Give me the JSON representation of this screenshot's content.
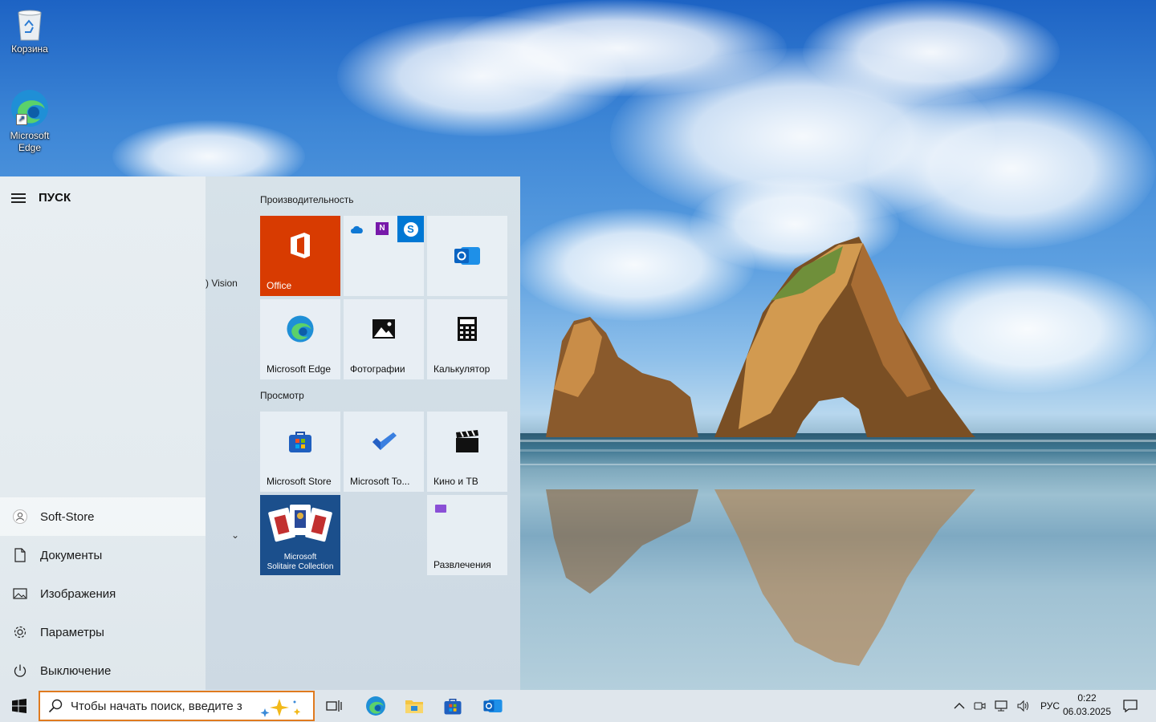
{
  "desktop": {
    "icons": [
      {
        "label": "Корзина"
      },
      {
        "label": "Microsoft Edge"
      }
    ]
  },
  "start_menu": {
    "title": "ПУСК",
    "partial_app_text": ") Vision",
    "nav": {
      "user": "Soft-Store",
      "documents": "Документы",
      "pictures": "Изображения",
      "settings": "Параметры",
      "power": "Выключение"
    },
    "groups": {
      "productivity": "Производительность",
      "explore": "Просмотр"
    },
    "tiles": {
      "office": "Office",
      "edge": "Microsoft Edge",
      "photos": "Фотографии",
      "calculator": "Калькулятор",
      "store": "Microsoft Store",
      "todo": "Microsoft To...",
      "movies": "Кино и ТВ",
      "solitaire_line1": "Microsoft",
      "solitaire_line2": "Solitaire Collection",
      "entertainment": "Развлечения"
    }
  },
  "taskbar": {
    "search_placeholder": "Чтобы начать поиск, введите з",
    "language": "РУС",
    "time": "0:22",
    "date": "06.03.2025"
  },
  "colors": {
    "office_tile": "#d83b01",
    "solitaire_tile": "#1b4f8c",
    "search_border": "#e07a1f",
    "accent": "#0078d4"
  }
}
